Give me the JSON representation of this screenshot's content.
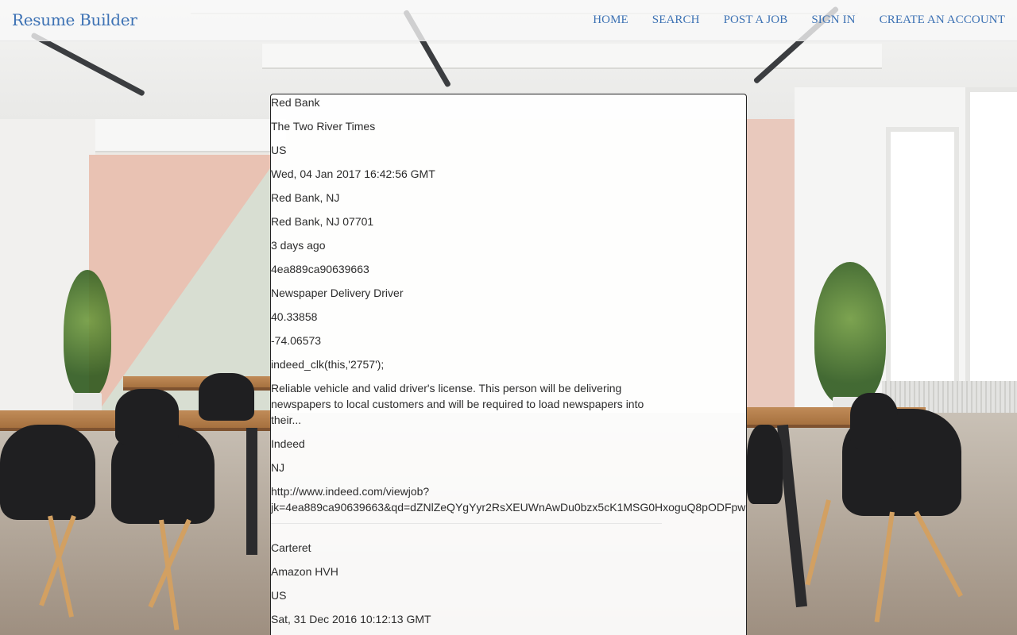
{
  "navbar": {
    "brand": "Resume Builder",
    "links": [
      "HOME",
      "SEARCH",
      "POST A JOB",
      "SIGN IN",
      "CREATE AN ACCOUNT"
    ]
  },
  "colors": {
    "link": "#3d72b4",
    "text": "#2c2c2c"
  },
  "jobs": [
    {
      "city": "Red Bank",
      "company": "The Two River Times",
      "country": "US",
      "date": "Wed, 04 Jan 2017 16:42:56 GMT",
      "formatted_location": "Red Bank, NJ",
      "formatted_location_full": "Red Bank, NJ 07701",
      "relative_time": "3 days ago",
      "jobkey": "4ea889ca90639663",
      "job_title": "Newspaper Delivery Driver",
      "latitude": "40.33858",
      "longitude": "-74.06573",
      "onmousedown": "indeed_clk(this,'2757');",
      "snippet": "Reliable vehicle and valid driver's license. This person will be delivering newspapers to local customers and will be required to load newspapers into their...",
      "source": "Indeed",
      "state": "NJ",
      "url_line1": "http://www.indeed.com/viewjob?",
      "url_line2": "jk=4ea889ca90639663&qd=dZNlZeQYgYyr2RsXEUWnAwDu0bzx5cK1MSG0HxoguQ8pODFpw"
    },
    {
      "city": "Carteret",
      "company": "Amazon HVH",
      "country": "US",
      "date": "Sat, 31 Dec 2016 10:12:13 GMT"
    }
  ]
}
